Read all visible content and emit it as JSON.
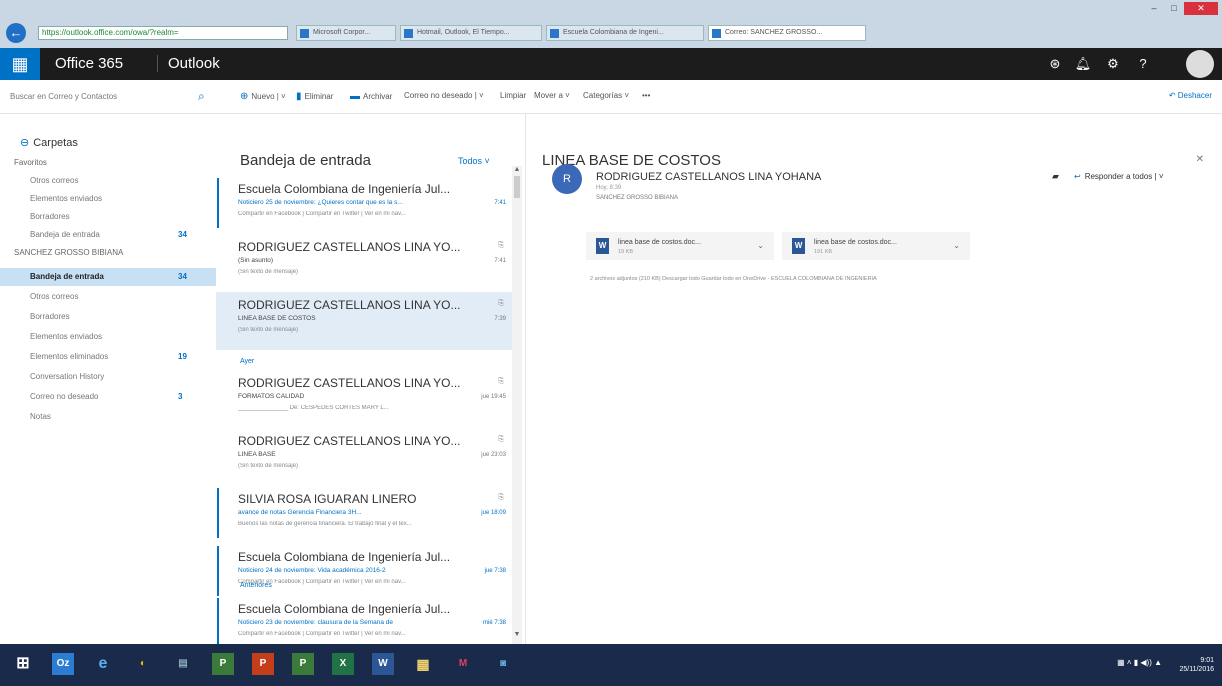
{
  "browser": {
    "address": "https://outlook.office.com/owa/?realm=",
    "tabs": [
      "Microsoft Corpor...",
      "Hotmail, Outlook, El Tiempo...",
      "Escuela Colombiana de Ingeni...",
      "Correo: SANCHEZ GROSSO..."
    ],
    "window_controls": [
      "–",
      "□",
      "✕"
    ]
  },
  "header": {
    "brand": "Office 365",
    "app": "Outlook"
  },
  "command_bar": {
    "search_placeholder": "Buscar en Correo y Contactos",
    "new": "Nuevo",
    "delete": "Eliminar",
    "archive": "Archivar",
    "junk": "Correo no deseado",
    "clean": "Limpiar",
    "move": "Mover a",
    "categories": "Categorías",
    "more": "•••",
    "undo": "Deshacer"
  },
  "nav": {
    "title": "Carpetas",
    "favorites": "Favoritos",
    "fav_items": [
      {
        "label": "Otros correos",
        "count": ""
      },
      {
        "label": "Elementos enviados",
        "count": ""
      },
      {
        "label": "Borradores",
        "count": ""
      },
      {
        "label": "Bandeja de entrada",
        "count": "34"
      }
    ],
    "account": "SANCHEZ GROSSO BIBIANA",
    "account_items": [
      {
        "label": "Bandeja de entrada",
        "count": "34"
      },
      {
        "label": "Otros correos",
        "count": ""
      },
      {
        "label": "Borradores",
        "count": ""
      },
      {
        "label": "Elementos enviados",
        "count": ""
      },
      {
        "label": "Elementos eliminados",
        "count": "19"
      },
      {
        "label": "Conversation History",
        "count": ""
      },
      {
        "label": "Correo no deseado",
        "count": "3"
      },
      {
        "label": "Notas",
        "count": ""
      }
    ]
  },
  "list": {
    "title": "Bandeja de entrada",
    "filter": "Todos",
    "group_yesterday": "Ayer",
    "group_more": "Anteriores",
    "messages": [
      {
        "from": "Escuela Colombiana de Ingeniería Jul...",
        "subject": "Noticiero 25 de noviembre: ¿Quieres contar que es la s...",
        "preview": "Compartir en Facebook | Compartir en Twitter | Ver en mi nav...",
        "time": "7:41"
      },
      {
        "from": "RODRIGUEZ CASTELLANOS LINA YO...",
        "subject": "(Sin asunto)",
        "preview": "(Sin texto de mensaje)",
        "time": "7:41"
      },
      {
        "from": "RODRIGUEZ CASTELLANOS LINA YO...",
        "subject": "LINEA BASE DE COSTOS",
        "preview": "(Sin texto de mensaje)",
        "time": "7:39"
      },
      {
        "from": "RODRIGUEZ CASTELLANOS LINA YO...",
        "subject": "FORMATOS CALIDAD",
        "preview": "_______________ De: CESPEDES CORTES MARY L...",
        "time": "jue 19:45"
      },
      {
        "from": "RODRIGUEZ CASTELLANOS LINA YO...",
        "subject": "LINEA BASE",
        "preview": "(Sin texto de mensaje)",
        "time": "jue 23:03"
      },
      {
        "from": "SILVIA ROSA IGUARAN LINERO",
        "subject": "avance de notas Gerencia Financiera 3H...",
        "preview": "Buenos las notas de gerencia financiera. El trabajo final y el tex...",
        "time": "jue 18:09"
      },
      {
        "from": "Escuela Colombiana de Ingeniería Jul...",
        "subject": "Noticiero 24 de noviembre: Vida académica 2016-2",
        "preview": "Compartir en Facebook | Compartir en Twitter | Ver en mi nav...",
        "time": "jue 7:38"
      },
      {
        "from": "Escuela Colombiana de Ingeniería Jul...",
        "subject": "Noticiero 23 de noviembre: clausura de la Semana de",
        "preview": "Compartir en Facebook | Compartir en Twitter | Ver en mi nav...",
        "time": "mié 7:38"
      }
    ]
  },
  "reading": {
    "subject": "LINEA BASE DE COSTOS",
    "avatar_initial": "R",
    "sender": "RODRIGUEZ CASTELLANOS LINA YOHANA",
    "time": "Hoy, 8:39",
    "to": "SANCHEZ GROSSO BIBIANA",
    "reply_all": "Responder a todos",
    "attachments": [
      {
        "name": "linea base de costos.doc...",
        "size": "19 KB"
      },
      {
        "name": "linea base de costos.doc...",
        "size": "191 KB"
      }
    ],
    "attach_meta": "2 archivos adjuntos (210 KB)   Descargar todo   Guardar todo en OneDrive - ESCUELA COLOMBIANA DE INGENIERIA"
  },
  "taskbar": {
    "apps": [
      "⊞",
      "Oz",
      "e",
      "◐",
      "▤",
      "P",
      "P",
      "P",
      "X",
      "W",
      "▦",
      "M",
      "◙"
    ],
    "clock_time": "9:01",
    "clock_date": "25/11/2016"
  },
  "colors": {
    "accent": "#0072c6",
    "header_bg": "#1c1c1c",
    "selected_folder": "#c7e0f4",
    "taskbar": "#1a2a4a"
  }
}
